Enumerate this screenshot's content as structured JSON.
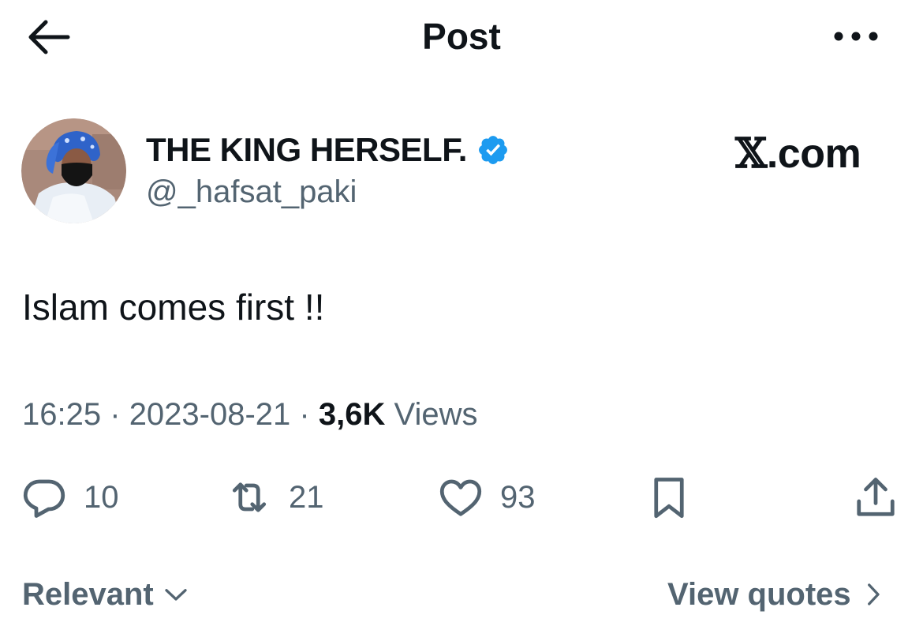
{
  "header": {
    "title": "Post",
    "back_icon": "arrow-left-icon",
    "more_icon": "more-horizontal-icon"
  },
  "author": {
    "display_name": "THE KING HERSELF.",
    "handle": "@_hafsat_paki",
    "verified": true,
    "verified_color": "#1d9bf0"
  },
  "brand": {
    "x_mark": "𝕏",
    "domain": ".com"
  },
  "post": {
    "text": "Islam comes first !!"
  },
  "meta": {
    "time": "16:25",
    "separator": "·",
    "date": "2023-08-21",
    "views_count": "3,6K",
    "views_label": "Views"
  },
  "actions": {
    "replies": "10",
    "reposts": "21",
    "likes": "93"
  },
  "footer": {
    "sort_label": "Relevant",
    "quotes_label": "View quotes"
  },
  "colors": {
    "text_primary": "#0f1419",
    "text_secondary": "#536471",
    "accent": "#1d9bf0",
    "background": "#ffffff"
  }
}
